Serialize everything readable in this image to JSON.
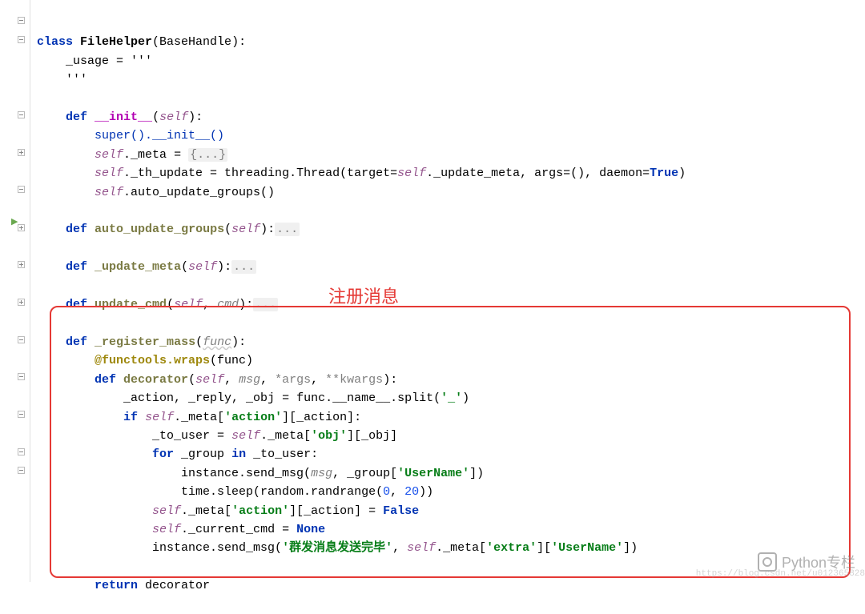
{
  "code": {
    "class_kw": "class",
    "class_name": "FileHelper",
    "base": "(BaseHandle):",
    "usage_line": "_usage = '''",
    "usage_end": "'''",
    "def_kw": "def",
    "init_name": "__init__",
    "init_params": "(",
    "self_kw": "self",
    "init_close": "):",
    "super_call": "super().__init__()",
    "meta_line_a": ".",
    "meta_attr": "_meta",
    "meta_assign": " = ",
    "meta_val": "{...}",
    "th_a": "._th_update = threading.Thread(target=",
    "th_b": "._update_meta, args=(), daemon=",
    "true_kw": "True",
    "th_c": ")",
    "auto_call": ".auto_update_groups()",
    "auto_name": "auto_update_groups",
    "auto_params": "(",
    "auto_close": "):",
    "ellipsis": "...",
    "update_meta_name": "_update_meta",
    "update_cmd_name": "update_cmd",
    "cmd_param": "cmd",
    "register_name": "_register_mass",
    "func_param": "func",
    "decor_line": "@functools.wraps",
    "decor_arg": "(func)",
    "decorator_name": "decorator",
    "dec_params_a": "(",
    "msg_param": "msg",
    "args_param": "*args",
    "kwargs_param": "**kwargs",
    "dec_close": "):",
    "split_line_a": "_action, _reply, _obj = func.__name__.split(",
    "split_str": "'_'",
    "split_close": ")",
    "if_kw": "if",
    "if_line_a": "._meta[",
    "action_str": "'action'",
    "if_line_b": "][_action]:",
    "to_user_a": "_to_user = ",
    "to_user_b": "._meta[",
    "obj_str": "'obj'",
    "to_user_c": "][_obj]",
    "for_kw": "for",
    "for_a": " _group ",
    "in_kw": "in",
    "for_b": " _to_user:",
    "send_a": "instance.send_msg(",
    "send_b": ", _group[",
    "username_str": "'UserName'",
    "send_c": "])",
    "sleep_a": "time.sleep(random.randrange(",
    "zero": "0",
    "twenty": "20",
    "sleep_c": "))",
    "setfalse_a": "._meta[",
    "setfalse_b": "][_action] = ",
    "false_kw": "False",
    "cur_a": "._current_cmd = ",
    "none_kw": "None",
    "final_a": "instance.send_msg(",
    "final_str": "'群发消息发送完毕'",
    "final_b": ", ",
    "final_c": "._meta[",
    "extra_str": "'extra'",
    "final_d": "][",
    "final_e": "])",
    "return_kw": "return",
    "return_val": " decorator"
  },
  "annotation": "注册消息",
  "watermark": "Python专栏",
  "watermark_url": "https://blog.csdn.net/u012365828"
}
